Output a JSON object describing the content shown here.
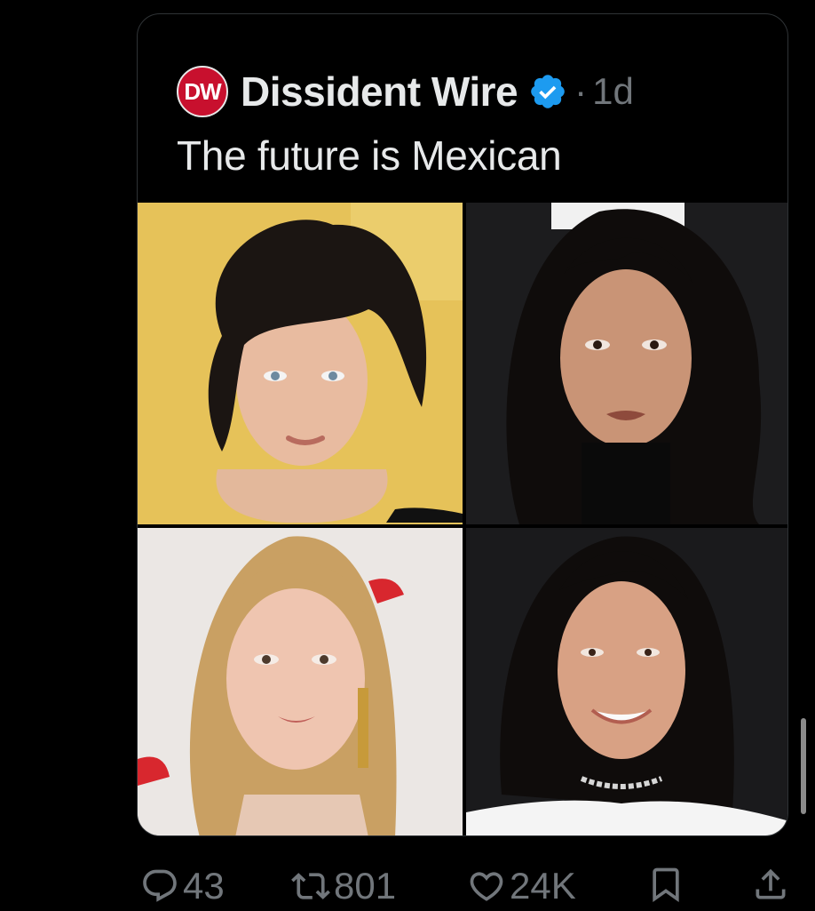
{
  "quoted_post": {
    "avatar_text": "DW",
    "author_name": "Dissident Wire",
    "separator": "·",
    "time": "1d",
    "text": "The future is Mexican",
    "photos": [
      {
        "description": "woman-curly-dark-hair-yellow-background"
      },
      {
        "description": "woman-long-dark-hair-black-background"
      },
      {
        "description": "woman-blonde-hair-light-background"
      },
      {
        "description": "woman-dark-hair-smiling-black-background"
      }
    ]
  },
  "actions": {
    "reply_count": "43",
    "retweet_count": "801",
    "like_count": "24K"
  },
  "colors": {
    "background": "#000000",
    "text": "#e7e9ea",
    "muted": "#71767b",
    "verified": "#1d9bf0",
    "avatar": "#c8102e"
  },
  "icons": [
    "reply-icon",
    "retweet-icon",
    "like-icon",
    "bookmark-icon",
    "share-icon",
    "verified-badge-icon"
  ]
}
